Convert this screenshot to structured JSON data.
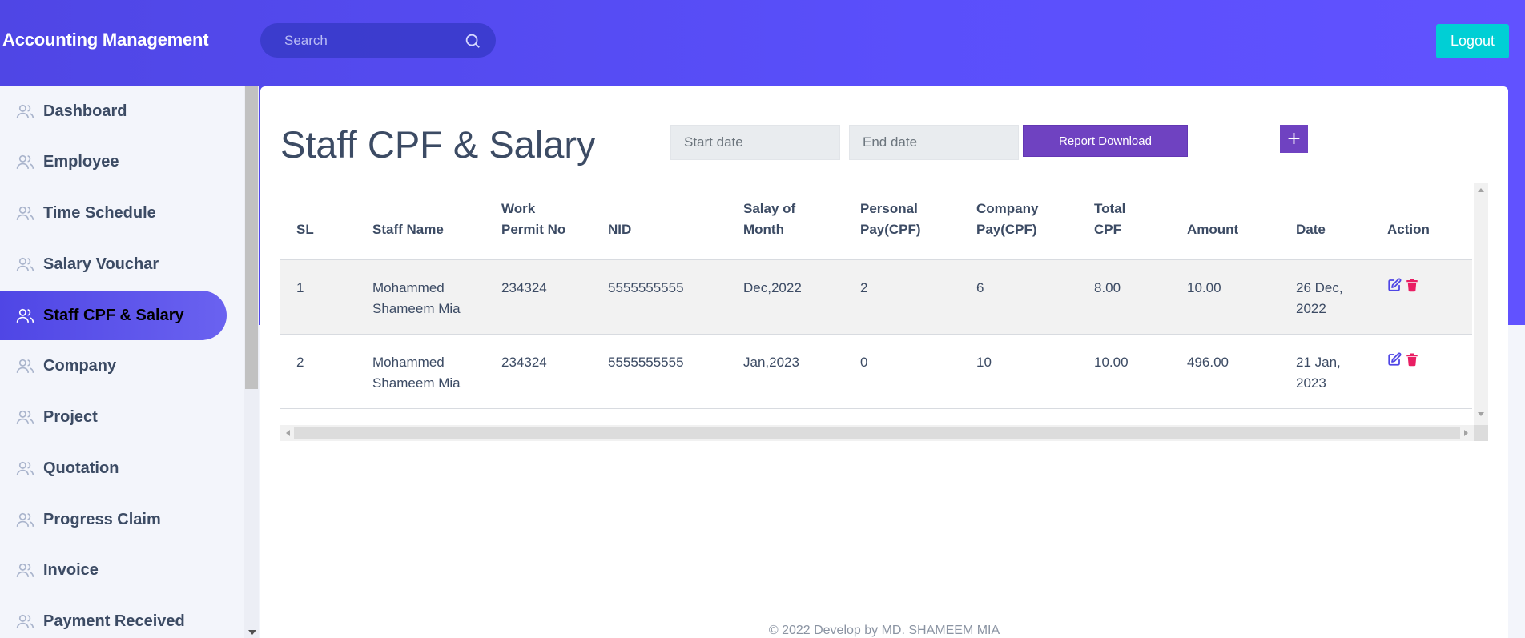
{
  "app": {
    "brand": "Accounting Management"
  },
  "header": {
    "search_placeholder": "Search",
    "search_icon": "search-icon",
    "logout_label": "Logout"
  },
  "sidebar": {
    "items": [
      {
        "label": "Dashboard",
        "icon": "users-icon",
        "active": false
      },
      {
        "label": "Employee",
        "icon": "users-icon",
        "active": false
      },
      {
        "label": "Time Schedule",
        "icon": "users-icon",
        "active": false
      },
      {
        "label": "Salary Vouchar",
        "icon": "users-icon",
        "active": false
      },
      {
        "label": "Staff CPF & Salary",
        "icon": "users-icon",
        "active": true
      },
      {
        "label": "Company",
        "icon": "users-icon",
        "active": false
      },
      {
        "label": "Project",
        "icon": "users-icon",
        "active": false
      },
      {
        "label": "Quotation",
        "icon": "users-icon",
        "active": false
      },
      {
        "label": "Progress Claim",
        "icon": "users-icon",
        "active": false
      },
      {
        "label": "Invoice",
        "icon": "users-icon",
        "active": false
      },
      {
        "label": "Payment Received",
        "icon": "users-icon",
        "active": false
      }
    ]
  },
  "main": {
    "title": "Staff CPF & Salary",
    "start_date_placeholder": "Start date",
    "end_date_placeholder": "End date",
    "report_button": "Report Download",
    "add_button": "+",
    "table": {
      "headers": {
        "sl": "SL",
        "staff_name": "Staff Name",
        "work_permit_1": "Work",
        "work_permit_2": "Permit No",
        "nid": "NID",
        "salary_month_1": "Salay of",
        "salary_month_2": "Month",
        "personal_1": "Personal",
        "personal_2": "Pay(CPF)",
        "company_1": "Company",
        "company_2": "Pay(CPF)",
        "total_1": "Total",
        "total_2": "CPF",
        "amount": "Amount",
        "date": "Date",
        "action": "Action"
      },
      "rows": [
        {
          "sl": "1",
          "staff_name_1": "Mohammed",
          "staff_name_2": "Shameem Mia",
          "work_permit": "234324",
          "nid": "5555555555",
          "month": "Dec,2022",
          "personal": "2",
          "company": "6",
          "total": "8.00",
          "amount": "10.00",
          "date_1": "26 Dec,",
          "date_2": "2022"
        },
        {
          "sl": "2",
          "staff_name_1": "Mohammed",
          "staff_name_2": "Shameem Mia",
          "work_permit": "234324",
          "nid": "5555555555",
          "month": "Jan,2023",
          "personal": "0",
          "company": "10",
          "total": "10.00",
          "amount": "496.00",
          "date_1": "21 Jan,",
          "date_2": "2023"
        }
      ]
    }
  },
  "footer": {
    "text": "© 2022 Develop by MD. SHAMEEM MIA"
  },
  "colors": {
    "header_gradient_start": "#4f46e5",
    "header_gradient_end": "#6152ff",
    "logout": "#00cfd5",
    "report_button": "#6f42c1",
    "edit_icon": "#4f46e5",
    "delete_icon": "#e91e63"
  }
}
